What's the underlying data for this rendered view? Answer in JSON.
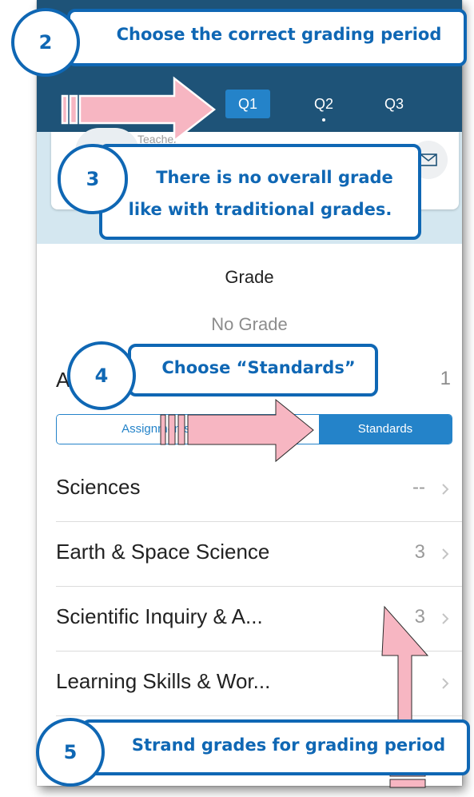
{
  "tabs": [
    {
      "label": "Q1",
      "active": true
    },
    {
      "label": "Q2",
      "active": false
    },
    {
      "label": "Q3",
      "active": false
    }
  ],
  "teacher_label": "Teacher",
  "grade": {
    "title": "Grade",
    "value": "No Grade"
  },
  "count": {
    "label_fragment": "A",
    "value": "1"
  },
  "segmented": {
    "left": "Assignments",
    "right": "Standards",
    "selected": "Standards"
  },
  "rows": [
    {
      "label": "Sciences",
      "value": "--"
    },
    {
      "label": "Earth & Space Science",
      "value": "3"
    },
    {
      "label": "Scientific Inquiry & A...",
      "value": "3"
    },
    {
      "label": "Learning Skills & Wor...",
      "value": ""
    }
  ],
  "callouts": {
    "c2": {
      "num": "2",
      "text": "Choose the correct grading period"
    },
    "c3": {
      "num": "3",
      "line1": "There is no overall grade",
      "line2": "like with traditional grades."
    },
    "c4": {
      "num": "4",
      "text": "Choose “Standards”"
    },
    "c5": {
      "num": "5",
      "text": "Strand grades for grading period"
    }
  },
  "colors": {
    "header": "#1e5378",
    "accent": "#2483c9",
    "callout": "#0f67b4",
    "arrow": "#f7b6c2"
  }
}
